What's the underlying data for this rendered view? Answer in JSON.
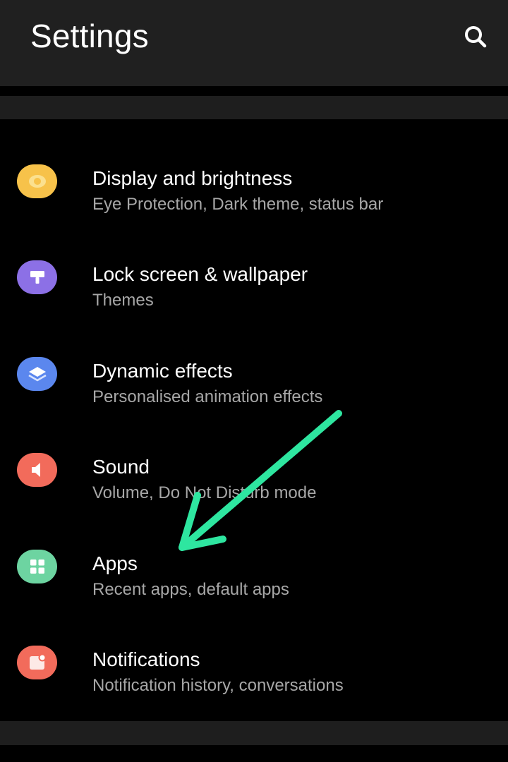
{
  "header": {
    "title": "Settings",
    "search_icon": "search-icon"
  },
  "items": [
    {
      "label": "Display and brightness",
      "sub": "Eye Protection, Dark theme, status bar",
      "icon": "brightness-icon",
      "color": "#F7C24A"
    },
    {
      "label": "Lock screen & wallpaper",
      "sub": "Themes",
      "icon": "brush-icon",
      "color": "#8C70E6"
    },
    {
      "label": "Dynamic effects",
      "sub": "Personalised animation effects",
      "icon": "layers-icon",
      "color": "#5B87EE"
    },
    {
      "label": "Sound",
      "sub": "Volume, Do Not Disturb mode",
      "icon": "speaker-icon",
      "color": "#F26B5B"
    },
    {
      "label": "Apps",
      "sub": "Recent apps, default apps",
      "icon": "apps-grid-icon",
      "color": "#6DD4A1"
    },
    {
      "label": "Notifications",
      "sub": "Notification history, conversations",
      "icon": "notification-icon",
      "color": "#F26B5B"
    }
  ],
  "annotation": {
    "arrow_color": "#2EE6A0"
  }
}
